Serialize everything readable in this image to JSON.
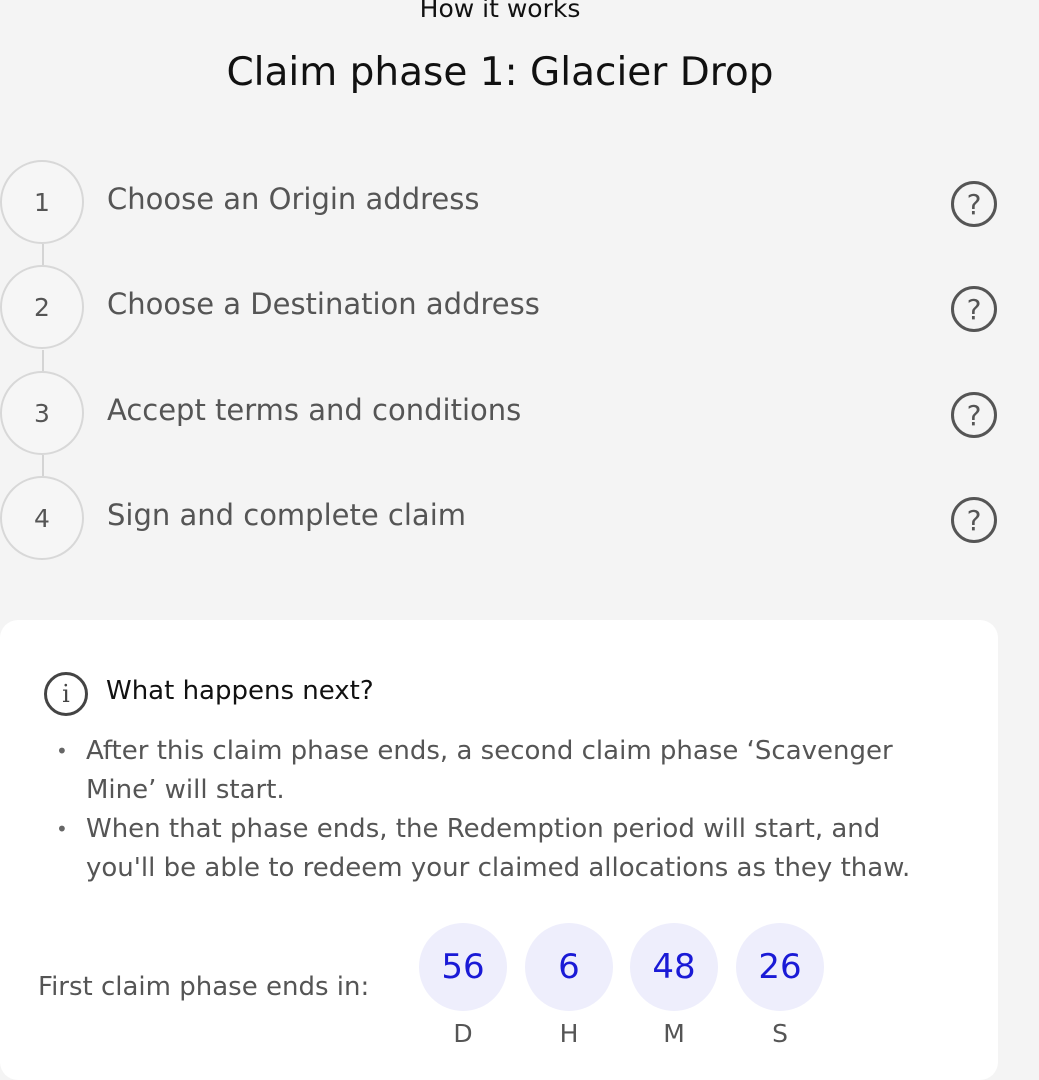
{
  "header": {
    "eyebrow": "How it works",
    "title": "Claim phase 1: Glacier Drop"
  },
  "steps": [
    {
      "number": "1",
      "label": "Choose an Origin address",
      "help_icon": "?"
    },
    {
      "number": "2",
      "label": "Choose a Destination address",
      "help_icon": "?"
    },
    {
      "number": "3",
      "label": "Accept terms and conditions",
      "help_icon": "?"
    },
    {
      "number": "4",
      "label": "Sign and complete claim",
      "help_icon": "?"
    }
  ],
  "info": {
    "icon": "i",
    "title": "What happens next?",
    "bullets": [
      "After this claim phase ends, a second claim phase ‘Scavenger Mine’ will start.",
      "When that phase ends, the Redemption period will start, and you'll be able to redeem your claimed allocations as they thaw."
    ]
  },
  "countdown": {
    "label": "First claim phase ends in:",
    "units": [
      {
        "value": "56",
        "caption": "D"
      },
      {
        "value": "6",
        "caption": "H"
      },
      {
        "value": "48",
        "caption": "M"
      },
      {
        "value": "26",
        "caption": "S"
      }
    ]
  },
  "colors": {
    "background": "#f4f4f4",
    "card": "#ffffff",
    "timer_bubble": "#eeeefc",
    "timer_text": "#1a1ad6"
  }
}
